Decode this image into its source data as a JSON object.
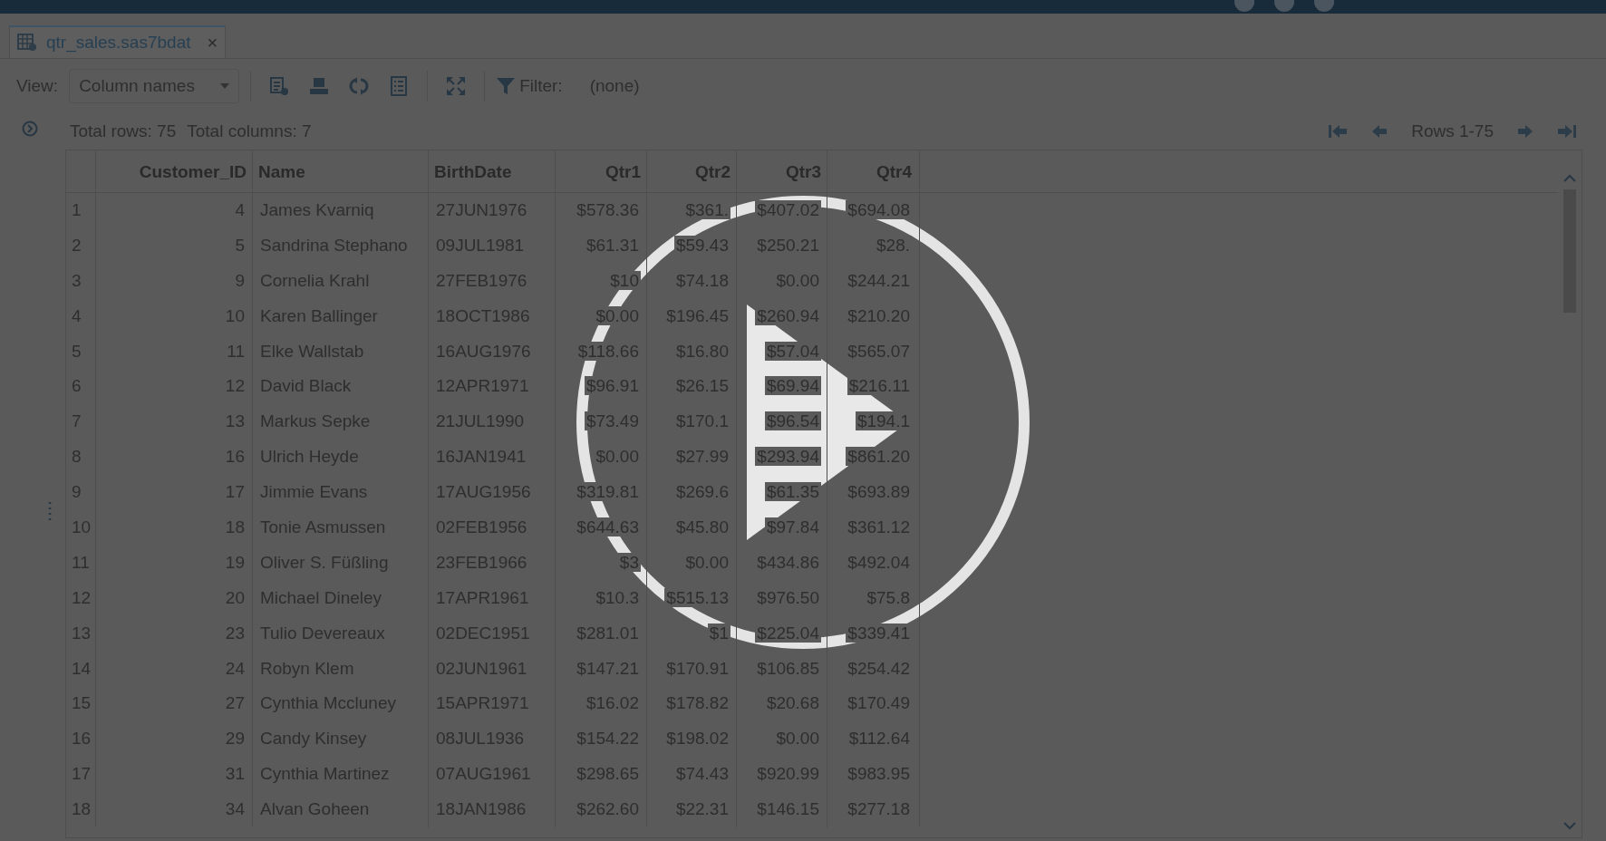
{
  "tab": {
    "title": "qtr_sales.sas7bdat",
    "close": "×",
    "selected": true
  },
  "toolbar": {
    "view_label": "View:",
    "view_value": "Column names",
    "filter_label": "Filter:",
    "filter_value": "(none)"
  },
  "info": {
    "rows": "Total rows: 75",
    "columns": "Total columns: 7"
  },
  "pager": {
    "range": "Rows 1-75"
  },
  "table": {
    "columns": [
      "Customer_ID",
      "Name",
      "BirthDate",
      "Qtr1",
      "Qtr2",
      "Qtr3",
      "Qtr4"
    ],
    "rows": [
      {
        "n": "1",
        "cells": [
          "4",
          "James Kvarniq",
          "27JUN1976",
          "$578.36",
          "$361.",
          "$407.02",
          "$694.08"
        ]
      },
      {
        "n": "2",
        "cells": [
          "5",
          "Sandrina Stephano",
          "09JUL1981",
          "$61.31",
          "$59.43",
          "$250.21",
          "$28."
        ]
      },
      {
        "n": "3",
        "cells": [
          "9",
          "Cornelia Krahl",
          "27FEB1976",
          "$10",
          "$74.18",
          "$0.00",
          "$244.21"
        ]
      },
      {
        "n": "4",
        "cells": [
          "10",
          "Karen Ballinger",
          "18OCT1986",
          "$0.00",
          "$196.45",
          "$260.94",
          "$210.20"
        ]
      },
      {
        "n": "5",
        "cells": [
          "11",
          "Elke Wallstab",
          "16AUG1976",
          "$118.66",
          "$16.80",
          "$57.04",
          "$565.07"
        ]
      },
      {
        "n": "6",
        "cells": [
          "12",
          "David Black",
          "12APR1971",
          "$96.91",
          "$26.15",
          "$69.94",
          "$216.11"
        ]
      },
      {
        "n": "7",
        "cells": [
          "13",
          "Markus Sepke",
          "21JUL1990",
          "$73.49",
          "$170.1",
          "$96.54",
          "$194.1"
        ]
      },
      {
        "n": "8",
        "cells": [
          "16",
          "Ulrich Heyde",
          "16JAN1941",
          "$0.00",
          "$27.99",
          "$293.94",
          "$861.20"
        ]
      },
      {
        "n": "9",
        "cells": [
          "17",
          "Jimmie Evans",
          "17AUG1956",
          "$319.81",
          "$269.6",
          "$61.35",
          "$693.89"
        ]
      },
      {
        "n": "10",
        "cells": [
          "18",
          "Tonie Asmussen",
          "02FEB1956",
          "$644.63",
          "$45.80",
          "$97.84",
          "$361.12"
        ]
      },
      {
        "n": "11",
        "cells": [
          "19",
          "Oliver S. Füßling",
          "23FEB1966",
          "$3",
          "$0.00",
          "$434.86",
          "$492.04"
        ]
      },
      {
        "n": "12",
        "cells": [
          "20",
          "Michael Dineley",
          "17APR1961",
          "$10.3",
          "$515.13",
          "$976.50",
          "$75.8"
        ]
      },
      {
        "n": "13",
        "cells": [
          "23",
          "Tulio Devereaux",
          "02DEC1951",
          "$281.01",
          "$1",
          "$225.04",
          "$339.41"
        ]
      },
      {
        "n": "14",
        "cells": [
          "24",
          "Robyn Klem",
          "02JUN1961",
          "$147.21",
          "$170.91",
          "$106.85",
          "$254.42"
        ]
      },
      {
        "n": "15",
        "cells": [
          "27",
          "Cynthia Mccluney",
          "15APR1971",
          "$16.02",
          "$178.82",
          "$20.68",
          "$170.49"
        ]
      },
      {
        "n": "16",
        "cells": [
          "29",
          "Candy Kinsey",
          "08JUL1936",
          "$154.22",
          "$198.02",
          "$0.00",
          "$112.64"
        ]
      },
      {
        "n": "17",
        "cells": [
          "31",
          "Cynthia Martinez",
          "07AUG1961",
          "$298.65",
          "$74.43",
          "$920.99",
          "$983.95"
        ]
      },
      {
        "n": "18",
        "cells": [
          "34",
          "Alvan Goheen",
          "18JAN1986",
          "$262.60",
          "$22.31",
          "$146.15",
          "$277.18"
        ]
      }
    ]
  }
}
